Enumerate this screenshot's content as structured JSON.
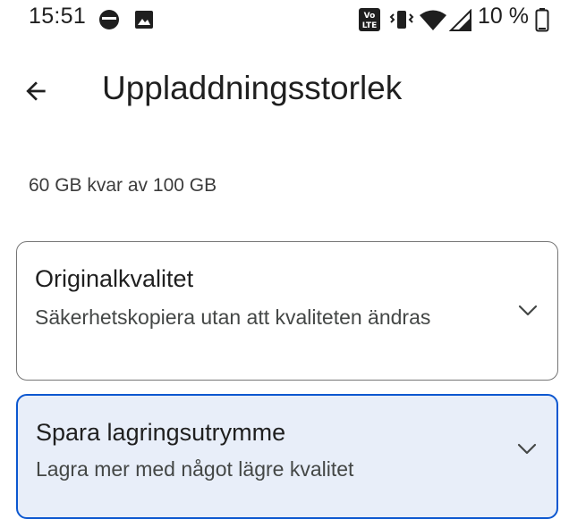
{
  "status_bar": {
    "time": "15:51",
    "battery": "10 %",
    "icons": [
      "media-icon",
      "image-icon",
      "volte-icon",
      "vibrate-icon",
      "wifi-icon",
      "signal-icon",
      "battery-icon"
    ]
  },
  "app_bar": {
    "title": "Uppladdningsstorlek",
    "back_icon": "arrow-back-icon"
  },
  "storage": {
    "text": "60 GB kvar av 100 GB"
  },
  "options": [
    {
      "title": "Originalkvalitet",
      "description": "Säkerhetskopiera utan att kvaliteten ändras",
      "selected": false
    },
    {
      "title": "Spara lagringsutrymme",
      "description": "Lagra mer med något lägre kvalitet",
      "selected": true
    }
  ],
  "colors": {
    "accent": "#0b57d0",
    "selected_background": "#e8eef9",
    "text_primary": "#1f1f1f",
    "text_secondary": "#444746"
  }
}
